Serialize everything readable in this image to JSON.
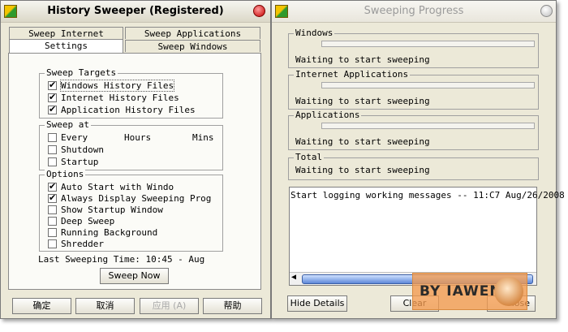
{
  "left_window": {
    "title": "History Sweeper (Registered)",
    "tabs": [
      "Sweep Internet",
      "Sweep Applications",
      "Settings",
      "Sweep Windows"
    ],
    "selected_tab": "Settings",
    "sweep_targets": {
      "label": "Sweep Targets",
      "items": [
        {
          "label": "Windows History Files",
          "checked": true
        },
        {
          "label": "Internet History Files",
          "checked": true
        },
        {
          "label": "Application History Files",
          "checked": true
        }
      ]
    },
    "sweep_at": {
      "label": "Sweep at",
      "every_label": "Every",
      "hours_label": "Hours",
      "mins_label": "Mins",
      "items": [
        {
          "label": "Shutdown",
          "checked": false
        },
        {
          "label": "Startup",
          "checked": false
        }
      ]
    },
    "options": {
      "label": "Options",
      "items": [
        {
          "label": "Auto Start with Windo",
          "checked": true
        },
        {
          "label": "Always Display Sweeping Prog",
          "checked": true
        },
        {
          "label": "Show Startup Window",
          "checked": false
        },
        {
          "label": "Deep Sweep",
          "checked": false
        },
        {
          "label": "Running Background",
          "checked": false
        },
        {
          "label": "Shredder",
          "checked": false
        }
      ]
    },
    "last_sweep": "Last Sweeping Time: 10:45 - Aug",
    "sweep_now": "Sweep Now",
    "buttons": {
      "ok": "确定",
      "cancel": "取消",
      "apply": "应用 (A)",
      "help": "帮助"
    }
  },
  "right_window": {
    "title": "Sweeping Progress",
    "sections": [
      {
        "label": "Windows",
        "status": "Waiting to start sweeping"
      },
      {
        "label": "Internet Applications",
        "status": "Waiting to start sweeping"
      },
      {
        "label": "Applications",
        "status": "Waiting to start sweeping"
      },
      {
        "label": "Total",
        "status": "Waiting to start sweeping"
      }
    ],
    "log_text": "Start logging working messages  -- 11:C7 Aug/26/2008",
    "hide_details": "Hide Details",
    "clear": "Clear",
    "close_partial": "lose"
  },
  "watermark": {
    "text": "BY IAWEN",
    "color": "#f39b50"
  }
}
